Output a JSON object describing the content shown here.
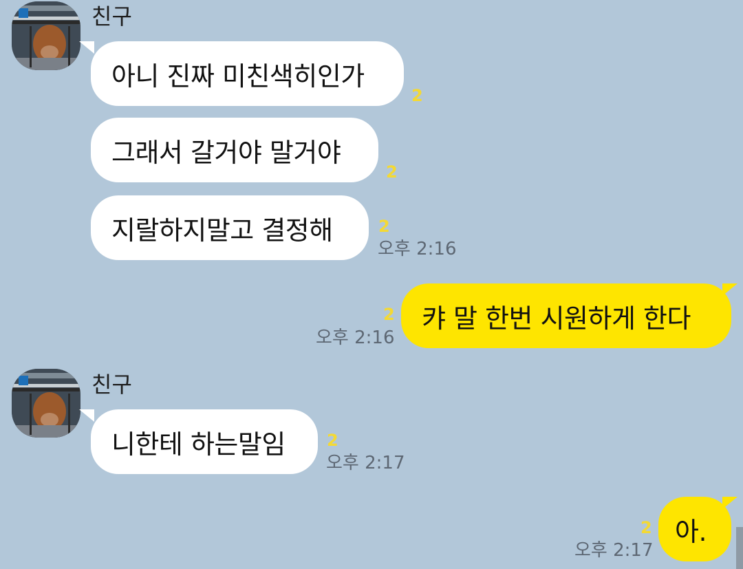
{
  "sender_name": "친구",
  "unread_count": "2",
  "messages": [
    {
      "side": "in",
      "text": "아니 진짜 미친색히인가"
    },
    {
      "side": "in",
      "text": "그래서 갈거야 말거야"
    },
    {
      "side": "in",
      "text": "지랄하지말고 결정해",
      "time": "오후 2:16"
    },
    {
      "side": "out",
      "text": "캬 말 한번 시원하게 한다",
      "time": "오후 2:16"
    },
    {
      "side": "in",
      "text": "니한테 하는말임",
      "time": "오후 2:17"
    },
    {
      "side": "out",
      "text": "아.",
      "time": "오후 2:17"
    }
  ],
  "colors": {
    "background": "#b2c7d9",
    "incoming_bubble": "#ffffff",
    "outgoing_bubble": "#fee500",
    "unread": "#f4d934"
  }
}
